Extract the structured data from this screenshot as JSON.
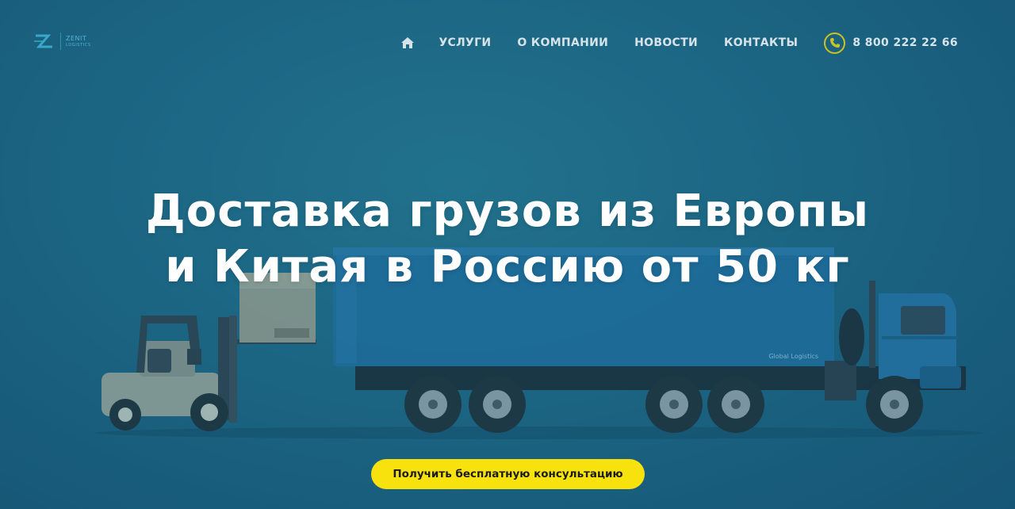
{
  "logo": {
    "name": "ZENIT",
    "tagline": "LOGISTICS"
  },
  "nav": {
    "home_icon": "home-icon",
    "items": [
      {
        "label": "УСЛУГИ"
      },
      {
        "label": "О КОМПАНИИ"
      },
      {
        "label": "НОВОСТИ"
      },
      {
        "label": "КОНТАКТЫ"
      }
    ],
    "phone": "8 800 222 22 66",
    "phone_icon": "phone-icon"
  },
  "hero": {
    "title_line1": "Доставка грузов из Европы",
    "title_line2": "и Китая в Россию от 50 кг",
    "truck_label": "Global Logistics"
  },
  "cta": {
    "label": "Получить бесплатную консультацию"
  },
  "colors": {
    "accent": "#f8e20e",
    "background": "#1c6683",
    "logo": "#5cc8ea"
  }
}
